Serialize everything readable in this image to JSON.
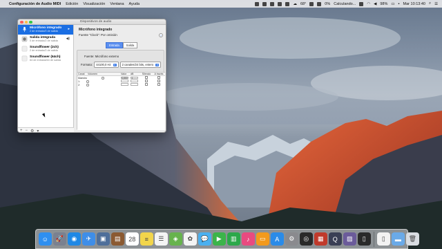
{
  "menubar": {
    "apple": "",
    "app_name": "Configuración de Audio MIDI",
    "menus": [
      "Edición",
      "Visualización",
      "Ventana",
      "Ayuda"
    ],
    "status": {
      "temperature": "68°",
      "battery": "98%",
      "clock": "Mar 10:13:40",
      "calc": "Calculando...",
      "percent": "0%"
    }
  },
  "window": {
    "title": "Dispositivos de audio",
    "devices": [
      {
        "name": "Micrófono integrado",
        "sub": "2 de entrada/0 de salida",
        "icon": "microphone-icon",
        "selected": true,
        "extra": "▸"
      },
      {
        "name": "Salida integrada",
        "sub": "0 de entrada/2 de salida",
        "icon": "speaker-icon",
        "selected": false,
        "extra": "◀)"
      },
      {
        "name": "Soundflower (2ch)",
        "sub": "2 de entrada/2 de salida",
        "icon": "flower-icon",
        "selected": false,
        "extra": ""
      },
      {
        "name": "Soundflower (64ch)",
        "sub": "64 de entrada/64 de salida",
        "icon": "flower-icon",
        "selected": false,
        "extra": ""
      }
    ],
    "footer": {
      "add": "+",
      "remove": "−",
      "gear": "⚙",
      "chevron": "▾"
    },
    "detail": {
      "title": "Micrófono integrado",
      "clock_label": "Fuente “Clock”:",
      "clock_value": "Por omisión",
      "help": "?",
      "tabs": [
        "Entrada",
        "Salida"
      ],
      "active_tab": "Entrada",
      "source_label": "Fuente:",
      "source_value": "Micrófono externo",
      "format_label": "Formato:",
      "format_rate": "44100,0 Hz",
      "format_bits": "2 canales/24 bits, entero",
      "table": {
        "headers": [
          "Canal",
          "Volumen",
          "Valor",
          "dB",
          "Silencio",
          "A través"
        ],
        "rows": [
          {
            "channel": "Maestro",
            "value": "0,500",
            "db": "1",
            "level": 0.5
          },
          {
            "channel": "1:",
            "value": "",
            "db": "",
            "level": 0
          },
          {
            "channel": "2:",
            "value": "",
            "db": "",
            "level": 0
          }
        ]
      }
    }
  },
  "dock": {
    "items": [
      {
        "name": "finder-icon",
        "glyph": "☺",
        "color": "#2e8ff0"
      },
      {
        "name": "launchpad-icon",
        "glyph": "🚀",
        "color": "#7a8190"
      },
      {
        "name": "safari-icon",
        "glyph": "◉",
        "color": "#1f88e5"
      },
      {
        "name": "mail-icon",
        "glyph": "✈",
        "color": "#3f8ee8"
      },
      {
        "name": "preview-icon",
        "glyph": "▣",
        "color": "#4f6f9a"
      },
      {
        "name": "notebook-icon",
        "glyph": "▤",
        "color": "#8b5a32"
      },
      {
        "name": "calendar-icon",
        "glyph": "28",
        "color": "#ffffff"
      },
      {
        "name": "notes-icon",
        "glyph": "≡",
        "color": "#f2d54b"
      },
      {
        "name": "reminders-icon",
        "glyph": "☰",
        "color": "#f4f4f4"
      },
      {
        "name": "maps-icon",
        "glyph": "◈",
        "color": "#67b34d"
      },
      {
        "name": "photos-icon",
        "glyph": "✿",
        "color": "#f4f4f4"
      },
      {
        "name": "messages-icon",
        "glyph": "💬",
        "color": "#4ab0f0"
      },
      {
        "name": "facetime-icon",
        "glyph": "▶",
        "color": "#3bb44a"
      },
      {
        "name": "numbers-icon",
        "glyph": "▥",
        "color": "#2ba84a"
      },
      {
        "name": "itunes-icon",
        "glyph": "♪",
        "color": "#e94a80"
      },
      {
        "name": "ibooks-icon",
        "glyph": "▭",
        "color": "#f39a1d"
      },
      {
        "name": "appstore-icon",
        "glyph": "A",
        "color": "#2a8be8"
      },
      {
        "name": "system-prefs-icon",
        "glyph": "⚙",
        "color": "#8a8a8e"
      },
      {
        "name": "dvd-player-icon",
        "glyph": "◎",
        "color": "#2a2a2a"
      },
      {
        "name": "photo-booth-icon",
        "glyph": "▦",
        "color": "#c03a2b"
      },
      {
        "name": "quicktime-icon",
        "glyph": "Q",
        "color": "#3a3f55"
      },
      {
        "name": "photo-stack-icon",
        "glyph": "▨",
        "color": "#6b5b9a"
      },
      {
        "name": "piano-icon",
        "glyph": "▯",
        "color": "#2a2a2a"
      },
      {
        "name": "sep",
        "glyph": "",
        "color": ""
      },
      {
        "name": "document-icon",
        "glyph": "▯",
        "color": "#f2f2f2"
      },
      {
        "name": "folder-icon",
        "glyph": "▬",
        "color": "#6aaae8"
      },
      {
        "name": "trash-icon",
        "glyph": "🗑",
        "color": "#d9dde2"
      }
    ]
  }
}
